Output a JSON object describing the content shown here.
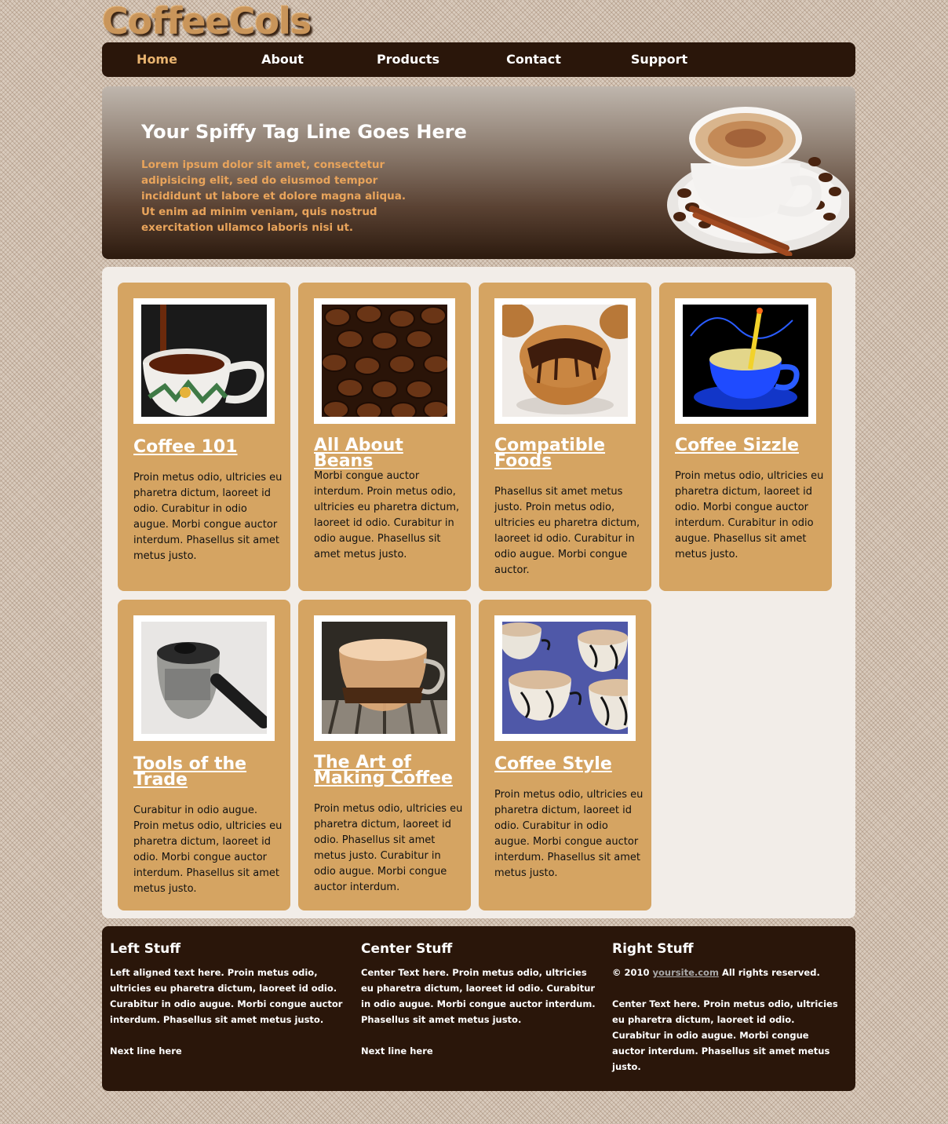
{
  "site": {
    "logo": "CoffeeCols"
  },
  "nav": {
    "items": [
      "Home",
      "About",
      "Products",
      "Contact",
      "Support"
    ],
    "active": "Home"
  },
  "hero": {
    "title": "Your Spiffy Tag Line Goes Here",
    "text": "Lorem ipsum dolor sit amet, consectetur adipisicing elit, sed do eiusmod tempor incididunt ut labore et dolore magna aliqua. Ut enim ad minim veniam, quis nostrud exercitation ullamco laboris nisi ut."
  },
  "cards": [
    {
      "title": "Coffee 101",
      "text": "Proin metus odio, ultricies eu pharetra dictum, laoreet id odio. Curabitur in odio augue. Morbi congue auctor interdum. Phasellus sit amet metus justo."
    },
    {
      "title": "All About Beans",
      "text": "Morbi congue auctor interdum. Proin metus odio, ultricies eu pharetra dictum, laoreet id odio. Curabitur in odio augue. Phasellus sit amet metus justo."
    },
    {
      "title": "Compatible Foods",
      "text": "Phasellus sit amet metus justo. Proin metus odio, ultricies eu pharetra dictum, laoreet id odio. Curabitur in odio augue. Morbi congue auctor."
    },
    {
      "title": "Coffee Sizzle",
      "text": "Proin metus odio, ultricies eu pharetra dictum, laoreet id odio. Morbi congue auctor interdum. Curabitur in odio augue. Phasellus sit amet metus justo."
    },
    {
      "title": "Tools of the Trade",
      "text": "Curabitur in odio augue. Proin metus odio, ultricies eu pharetra dictum, laoreet id odio. Morbi congue auctor interdum. Phasellus sit amet metus justo."
    },
    {
      "title": "The Art of Making Coffee",
      "text": "Proin metus odio, ultricies eu pharetra dictum, laoreet id odio. Phasellus sit amet metus justo. Curabitur in odio augue. Morbi congue auctor interdum."
    },
    {
      "title": "Coffee Style",
      "text": "Proin metus odio, ultricies eu pharetra dictum, laoreet id odio. Curabitur in odio augue. Morbi congue auctor interdum. Phasellus sit amet metus justo."
    }
  ],
  "footer": {
    "left": {
      "title": "Left Stuff",
      "text": "Left aligned text here. Proin metus odio, ultricies eu pharetra dictum, laoreet id odio. Curabitur in odio augue. Morbi congue auctor interdum. Phasellus sit amet metus justo.",
      "next_line": "Next line here"
    },
    "center": {
      "title": "Center Stuff",
      "text": "Center Text here. Proin metus odio, ultricies eu pharetra dictum, laoreet id odio. Curabitur in odio augue. Morbi congue auctor interdum. Phasellus sit amet metus justo.",
      "next_line": "Next line here"
    },
    "right": {
      "title": "Right Stuff",
      "copyright_prefix": "© 2010",
      "link": "yoursite.com",
      "copyright_suffix": "All rights reserved.",
      "text": "Center Text here. Proin metus odio, ultricies eu pharetra dictum, laoreet id odio. Curabitur in odio augue. Morbi congue auctor interdum. Phasellus sit amet metus justo."
    }
  },
  "colors": {
    "nav_bg": "#2a160a",
    "card_bg": "#d5a462",
    "content_bg": "#f2ede8",
    "accent": "#e8b36f",
    "hero_text": "#e9a45b"
  }
}
